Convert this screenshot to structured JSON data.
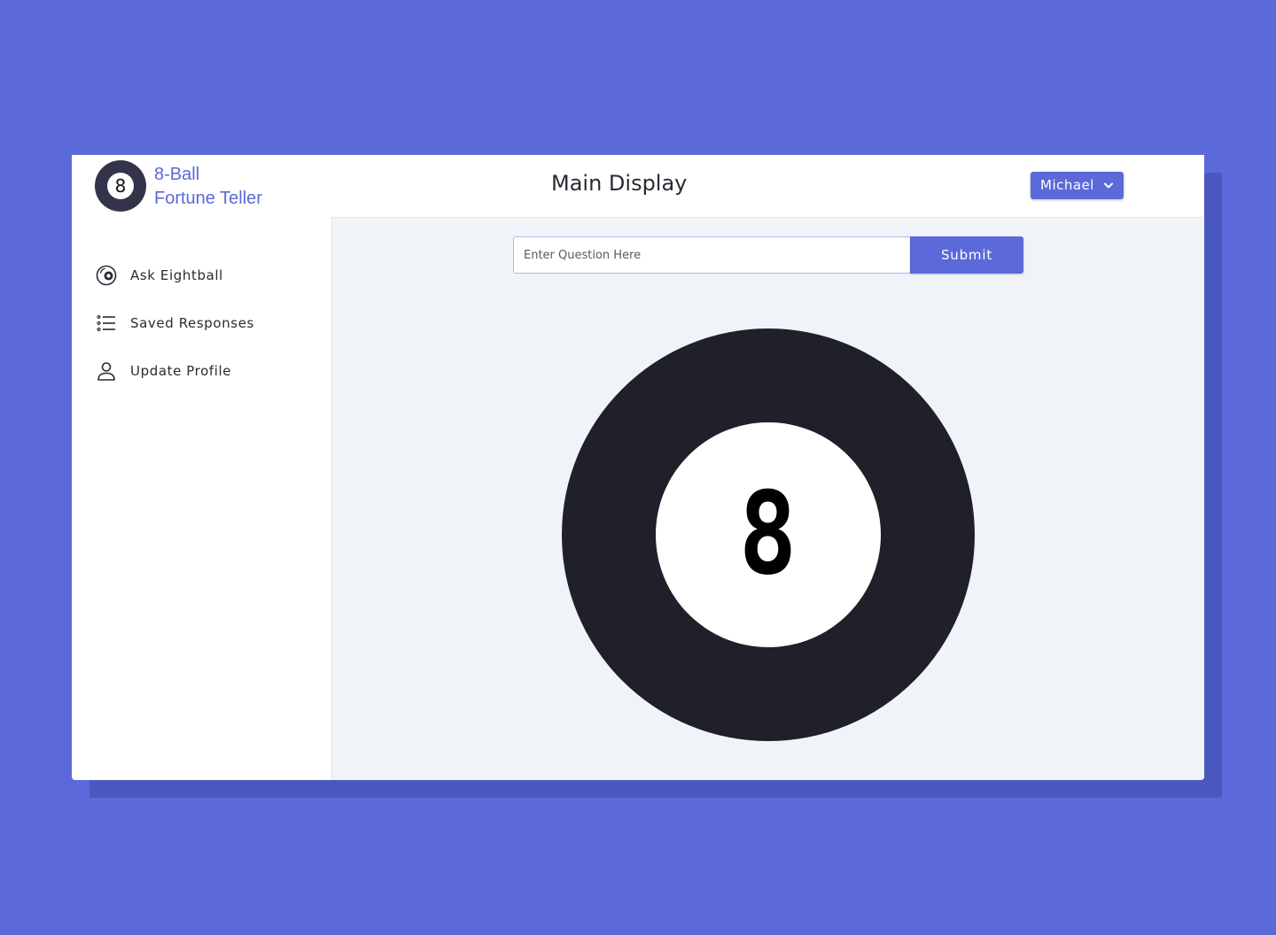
{
  "app": {
    "logo_number": "8",
    "brand_line1": "8-Ball",
    "brand_line2": "Fortune Teller"
  },
  "header": {
    "title": "Main Display",
    "user_menu": {
      "label": "Michael",
      "icon": "chevron-down-icon"
    }
  },
  "sidebar": {
    "items": [
      {
        "label": "Ask Eightball",
        "icon": "eightball-icon"
      },
      {
        "label": "Saved Responses",
        "icon": "list-icon"
      },
      {
        "label": "Update Profile",
        "icon": "user-icon"
      }
    ]
  },
  "main": {
    "question": {
      "value": "",
      "placeholder": "Enter Question Here"
    },
    "submit_label": "Submit",
    "ball_number": "8"
  },
  "colors": {
    "accent": "#5b69d9",
    "ball": "#1f2029",
    "main_bg": "#f0f3f8"
  }
}
